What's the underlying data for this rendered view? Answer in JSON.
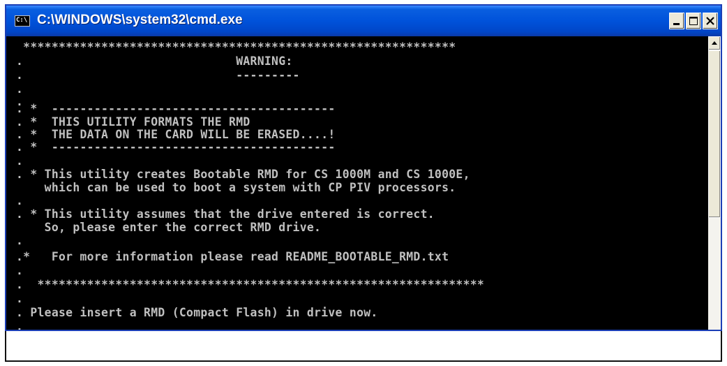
{
  "window": {
    "title": "C:\\WINDOWS\\system32\\cmd.exe",
    "icon_glyph": "C:\\"
  },
  "icons": {
    "app": "cmd-icon",
    "minimize": "minimize-icon",
    "maximize": "maximize-icon",
    "close": "close-icon",
    "scroll_up": "scroll-up-arrow-icon"
  },
  "colors": {
    "titlebar": "#0052da",
    "console_background": "#000000",
    "console_text": "#c0c0c0"
  },
  "console": {
    "lines": [
      " *************************************************************",
      ".                              WARNING:",
      ".                              ---------",
      ".",
      ".",
      ". *  ----------------------------------------",
      ". *  THIS UTILITY FORMATS THE RMD",
      ". *  THE DATA ON THE CARD WILL BE ERASED....!",
      ". *  ----------------------------------------",
      ".",
      ". * This utility creates Bootable RMD for CS 1000M and CS 1000E,",
      "    which can be used to boot a system with CP PIV processors.",
      ".",
      ". * This utility assumes that the drive entered is correct.",
      "    So, please enter the correct RMD drive.",
      ".",
      ".*   For more information please read README_BOOTABLE_RMD.txt",
      ".",
      ".  ***************************************************************",
      ".",
      ". Please insert a RMD (Compact Flash) in drive now.",
      "."
    ]
  }
}
